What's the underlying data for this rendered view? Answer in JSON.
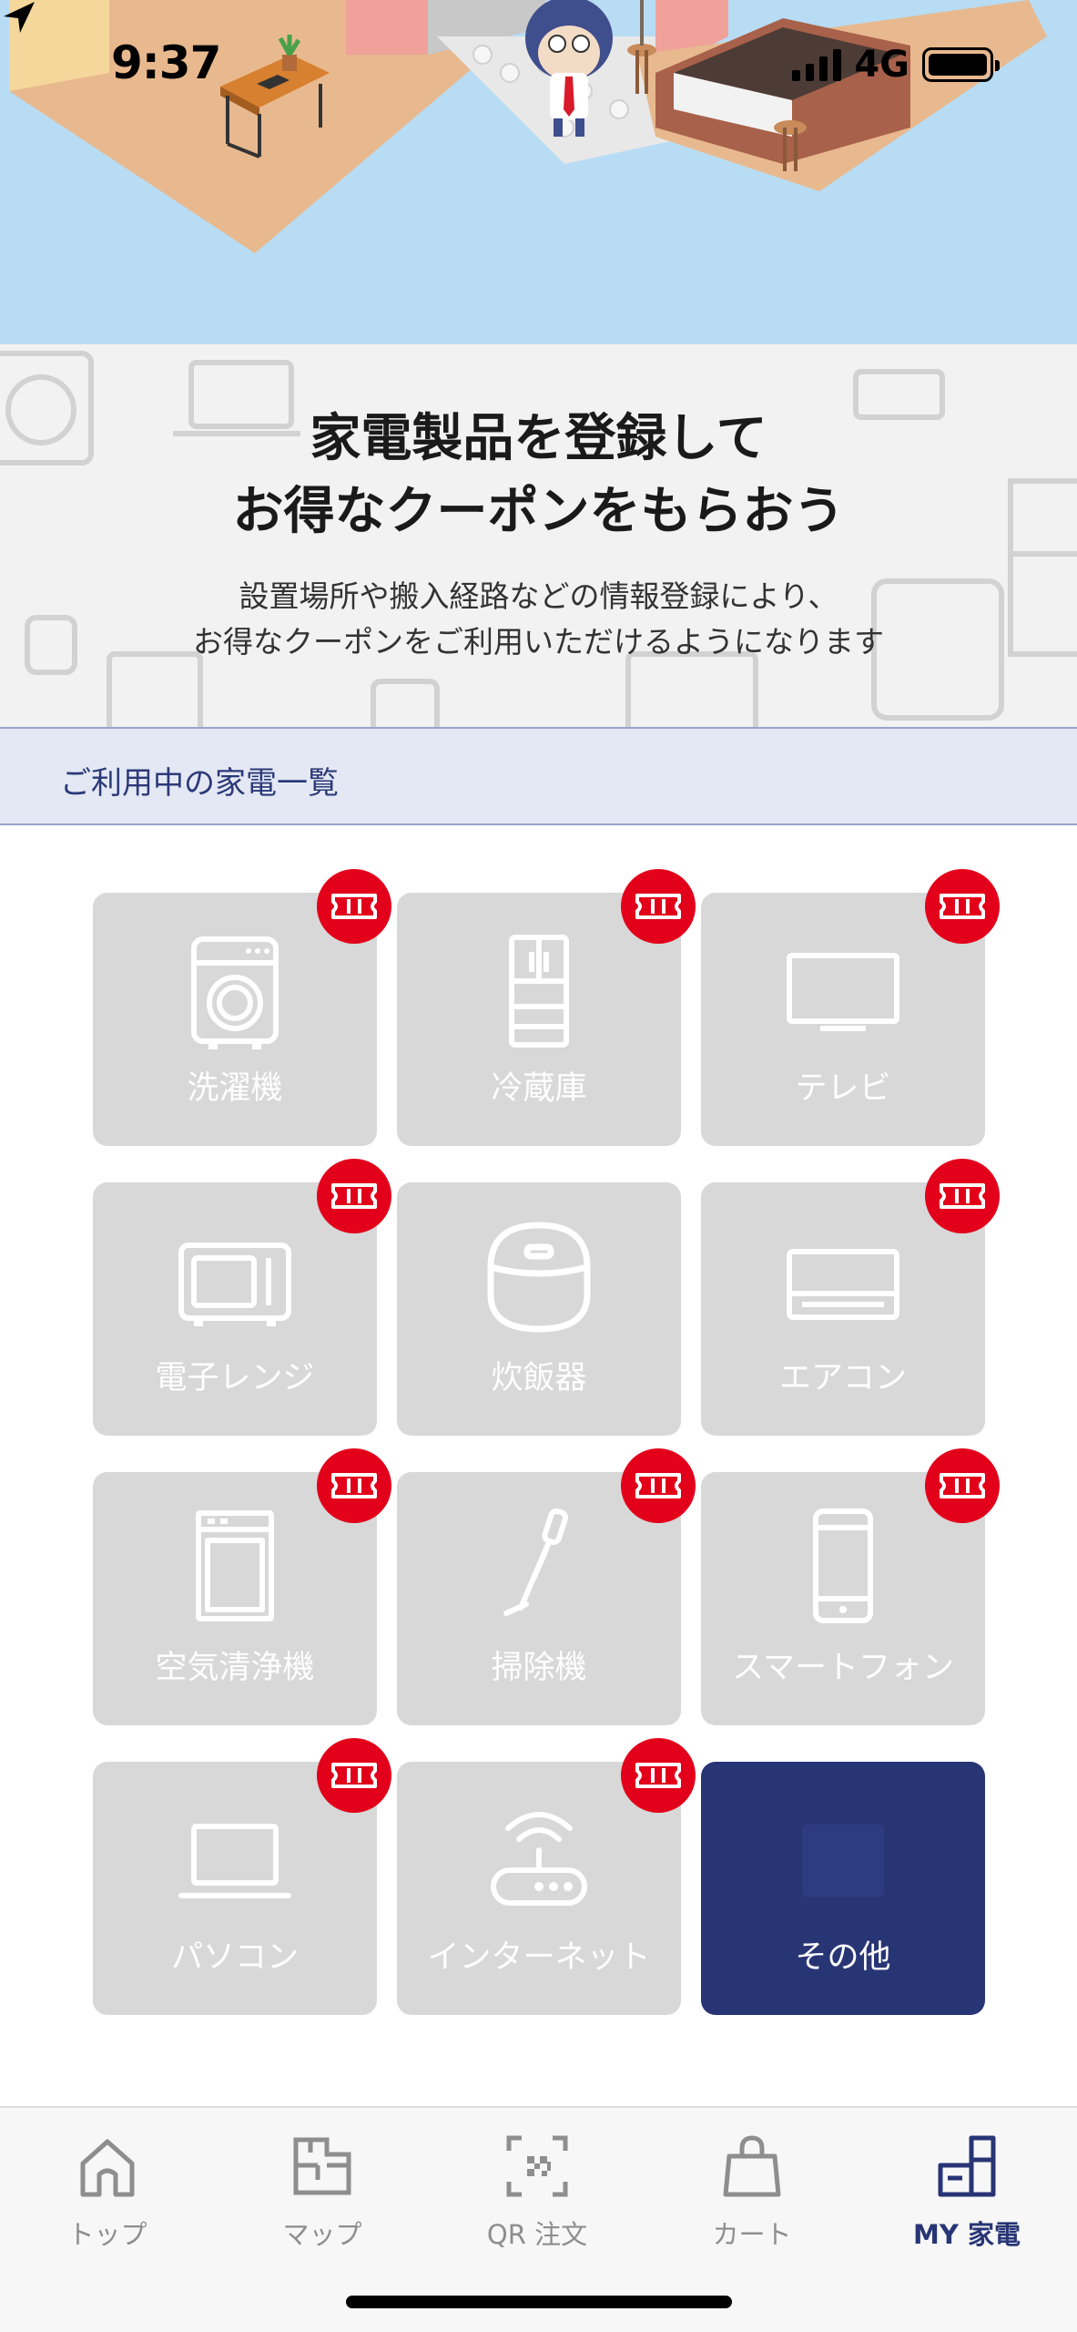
{
  "status_bar": {
    "time": "9:37",
    "network": "4G",
    "battery_level": 1.0
  },
  "intro": {
    "title_line1": "家電製品を登録して",
    "title_line2": "お得なクーポンをもらおう",
    "desc_line1": "設置場所や搬入経路などの情報登録により、",
    "desc_line2": "お得なクーポンをご利用いただけるようになります"
  },
  "section": {
    "title": "ご利用中の家電一覧"
  },
  "appliances": [
    {
      "label": "洗濯機",
      "icon": "washing-machine-icon",
      "coupon": true
    },
    {
      "label": "冷蔵庫",
      "icon": "refrigerator-icon",
      "coupon": true
    },
    {
      "label": "テレビ",
      "icon": "tv-icon",
      "coupon": true
    },
    {
      "label": "電子レンジ",
      "icon": "microwave-icon",
      "coupon": true
    },
    {
      "label": "炊飯器",
      "icon": "rice-cooker-icon",
      "coupon": false
    },
    {
      "label": "エアコン",
      "icon": "air-conditioner-icon",
      "coupon": true
    },
    {
      "label": "空気清浄機",
      "icon": "air-purifier-icon",
      "coupon": true
    },
    {
      "label": "掃除機",
      "icon": "vacuum-cleaner-icon",
      "coupon": true
    },
    {
      "label": "スマートフォン",
      "icon": "smartphone-icon",
      "coupon": true
    },
    {
      "label": "パソコン",
      "icon": "laptop-icon",
      "coupon": true
    },
    {
      "label": "インターネット",
      "icon": "router-icon",
      "coupon": true
    },
    {
      "label": "その他",
      "icon": "other-icon",
      "coupon": false,
      "selected": true
    }
  ],
  "tabbar": {
    "items": [
      {
        "label": "トップ",
        "icon": "home-icon"
      },
      {
        "label": "マップ",
        "icon": "floor-map-icon"
      },
      {
        "label": "QR 注文",
        "icon": "qr-code-icon"
      },
      {
        "label": "カート",
        "icon": "shopping-bag-icon"
      },
      {
        "label": "MY 家電",
        "icon": "my-appliance-icon",
        "active": true
      }
    ]
  },
  "colors": {
    "brand_navy": "#283575",
    "coupon_red": "#e2001a",
    "tile_gray": "#d8d8d8",
    "hero_sky": "#b8dcf4",
    "section_bg": "#e4e8f4"
  }
}
